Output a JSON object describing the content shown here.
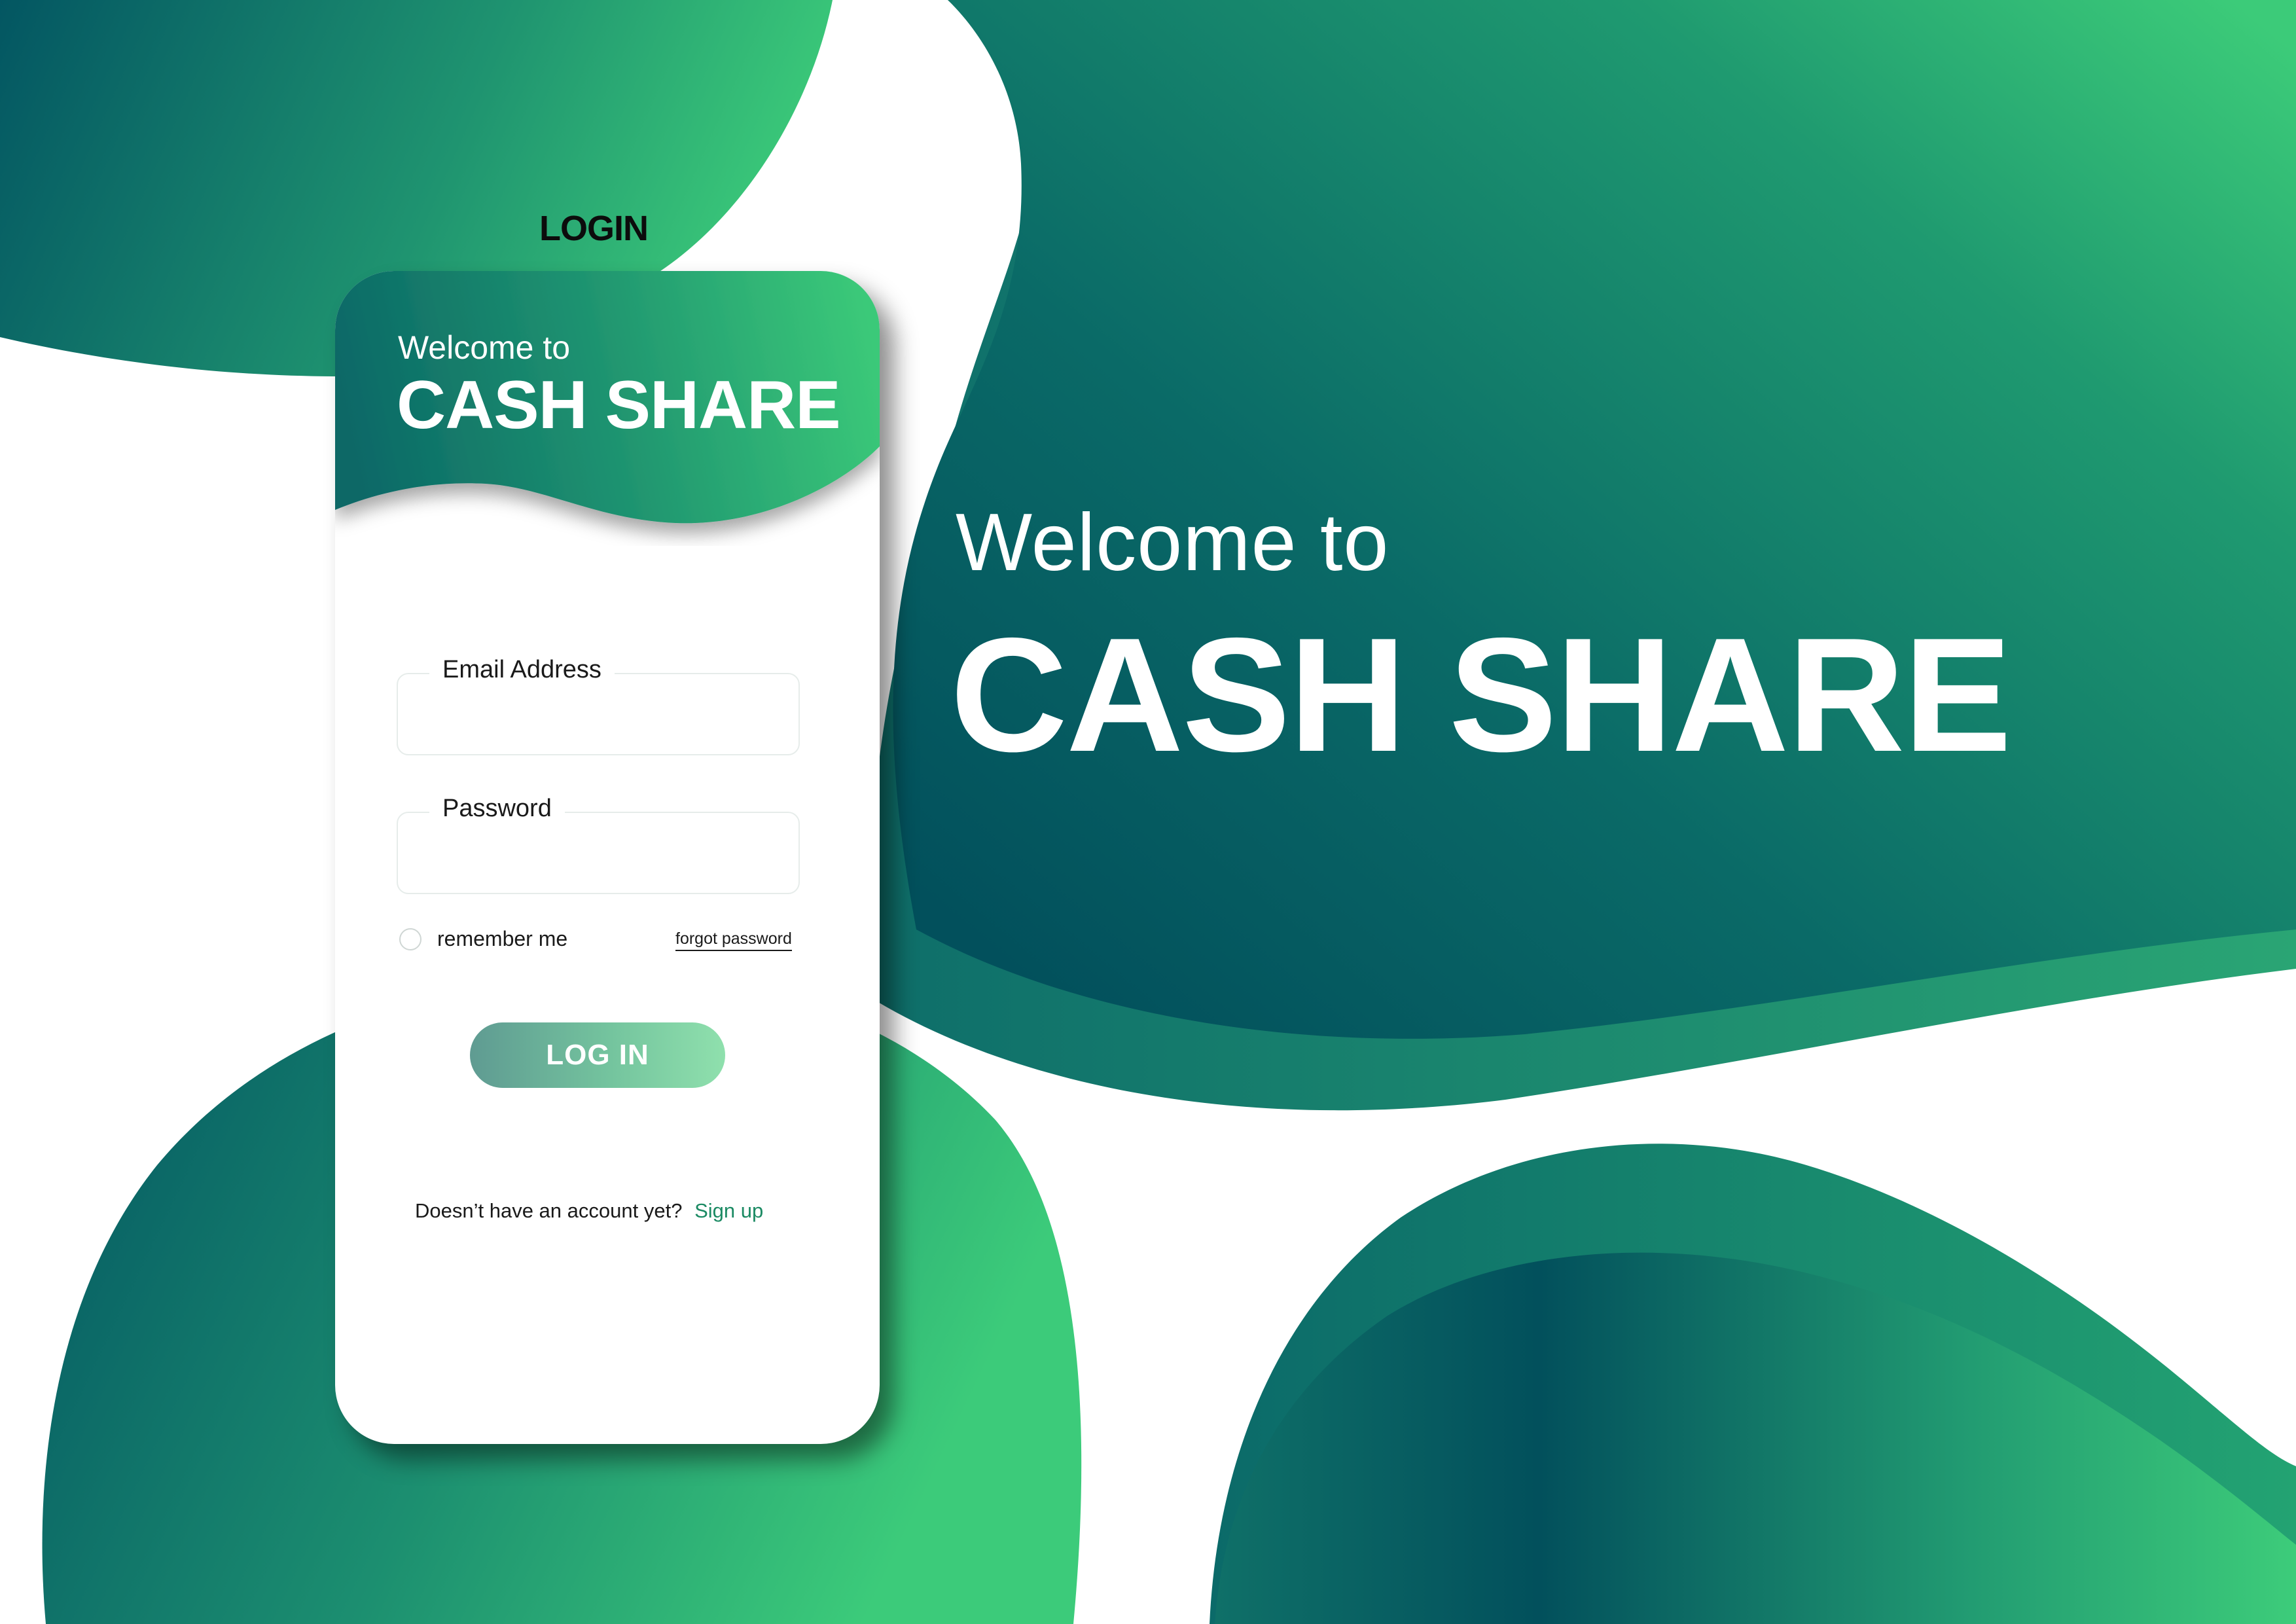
{
  "screen_title": "LOGIN",
  "phone": {
    "welcome": "Welcome to",
    "brand": "CASH SHARE"
  },
  "form": {
    "email_label": "Email Address",
    "email_value": "",
    "password_label": "Password",
    "password_value": "",
    "remember_label": "remember me",
    "remember_checked": false,
    "forgot_label": "forgot password",
    "login_label": "LOG IN",
    "signup_prompt": "Doesn’t have an account yet?",
    "signup_label": "Sign up"
  },
  "hero": {
    "welcome": "Welcome to",
    "brand": "CASH SHARE"
  },
  "colors": {
    "dark_teal": "#02525d",
    "green": "#3ccb78",
    "link": "#1b8a63"
  }
}
